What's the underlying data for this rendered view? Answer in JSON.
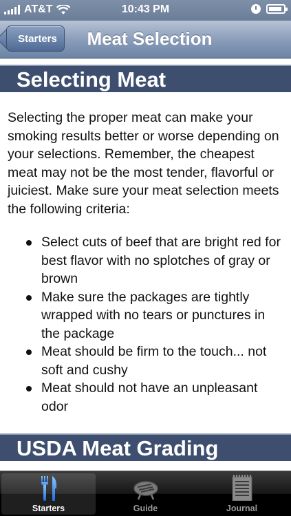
{
  "status_bar": {
    "carrier": "AT&T",
    "time": "10:43 PM"
  },
  "nav": {
    "back_label": "Starters",
    "title": "Meat Selection"
  },
  "content": {
    "section1_title": "Selecting Meat",
    "paragraph": "Selecting the proper meat can make your smoking results better or worse depending on your selections. Remember, the cheapest meat may not be the most tender, flavorful or juiciest. Make sure your meat selection meets the following criteria:",
    "bullets": [
      "Select cuts of beef that are bright red for best flavor with no splotches of gray or brown",
      "Make sure the packages are tightly wrapped with no tears or punctures in the package",
      "Meat should be firm to the touch... not soft and cushy",
      "Meat should not have an unpleasant odor"
    ],
    "section2_title": "USDA Meat Grading"
  },
  "tab_bar": {
    "tabs": [
      {
        "label": "Starters",
        "icon": "fork-knife-icon",
        "active": true
      },
      {
        "label": "Guide",
        "icon": "grill-icon",
        "active": false
      },
      {
        "label": "Journal",
        "icon": "notepad-icon",
        "active": false
      }
    ]
  },
  "colors": {
    "nav_blue": "#6d84a6",
    "section_header": "#3e4e6e",
    "active_tab_icon": "#3a8ef0"
  }
}
